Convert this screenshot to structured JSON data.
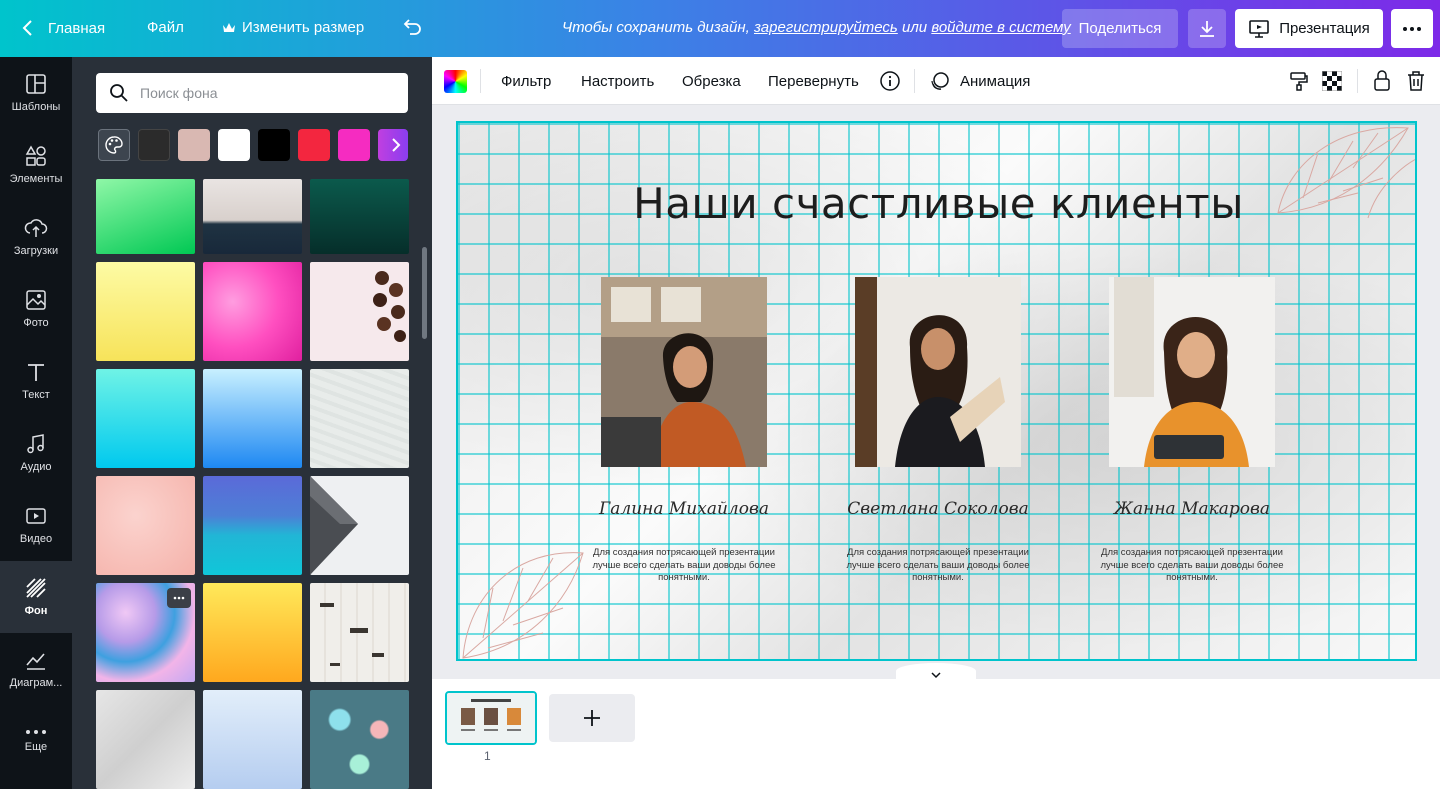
{
  "topbar": {
    "home_label": "Главная",
    "file_label": "Файл",
    "resize_label": "Изменить размер",
    "save_msg_prefix": "Чтобы сохранить дизайн,",
    "register_link": "зарегистрируйтесь",
    "or_text": "или",
    "login_link": "войдите в систему",
    "share_label": "Поделиться",
    "present_label": "Презентация"
  },
  "sidebar": {
    "items": [
      {
        "label": "Шаблоны",
        "icon": "templates-icon"
      },
      {
        "label": "Элементы",
        "icon": "elements-icon"
      },
      {
        "label": "Загрузки",
        "icon": "uploads-icon"
      },
      {
        "label": "Фото",
        "icon": "photo-icon"
      },
      {
        "label": "Текст",
        "icon": "text-icon"
      },
      {
        "label": "Аудио",
        "icon": "audio-icon"
      },
      {
        "label": "Видео",
        "icon": "video-icon"
      },
      {
        "label": "Фон",
        "icon": "background-icon"
      },
      {
        "label": "Диаграм...",
        "icon": "chart-icon"
      },
      {
        "label": "Еще",
        "icon": "more-icon"
      }
    ],
    "active": "Фон"
  },
  "panel": {
    "search_placeholder": "Поиск фона",
    "swatch_colors": [
      "#2b2b2b",
      "#d9b8b2",
      "#ffffff",
      "#000000",
      "#f3263f",
      "#f52cc1",
      "#c03fe0"
    ]
  },
  "toolbar": {
    "filter_label": "Фильтр",
    "adjust_label": "Настроить",
    "crop_label": "Обрезка",
    "flip_label": "Перевернуть",
    "animate_label": "Анимация"
  },
  "slide": {
    "title": "Наши счастливые клиенты",
    "people": [
      {
        "name": "Галина Михайлова",
        "desc": "Для создания потрясающей презентации лучше всего сделать ваши доводы более понятными."
      },
      {
        "name": "Светлана Соколова",
        "desc": "Для создания потрясающей презентации лучше всего сделать ваши доводы более понятными."
      },
      {
        "name": "Жанна Макарова",
        "desc": "Для создания потрясающей презентации лучше всего сделать ваши доводы более понятными."
      }
    ]
  },
  "filmstrip": {
    "page_number": "1"
  },
  "colors": {
    "accent": "#00c4cc",
    "brand_purple": "#7d2ae8",
    "panel_bg": "#293039",
    "nav_bg": "#0e1318"
  }
}
